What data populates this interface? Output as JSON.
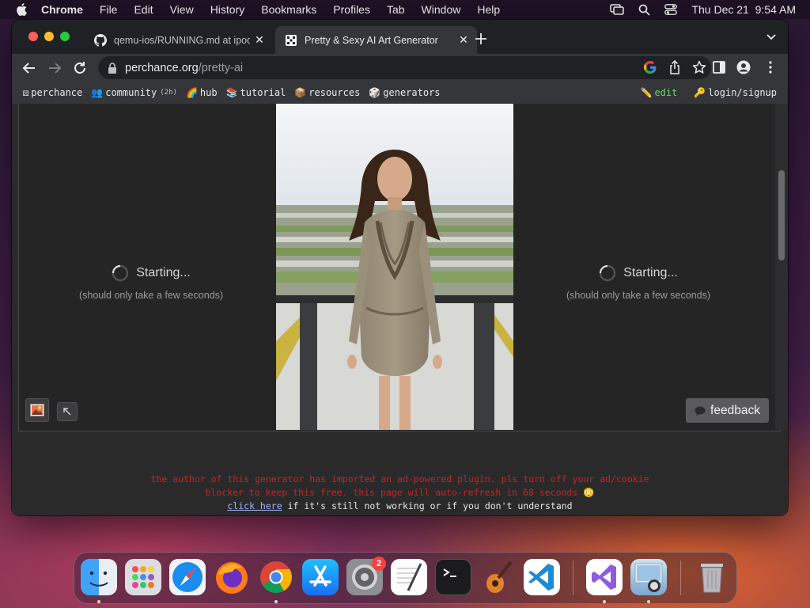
{
  "menubar": {
    "app": "Chrome",
    "items": [
      "File",
      "Edit",
      "View",
      "History",
      "Bookmarks",
      "Profiles",
      "Tab",
      "Window",
      "Help"
    ],
    "clock": "Thu Dec 21  9:54 AM"
  },
  "tabs": [
    {
      "title": "qemu-ios/RUNNING.md at ipod",
      "favicon": "github-icon",
      "active": false
    },
    {
      "title": "Pretty & Sexy AI Art Generator",
      "favicon": "perchance-icon",
      "active": true
    }
  ],
  "address": {
    "host": "perchance.org",
    "path": "/pretty-ai"
  },
  "bookmarks": {
    "items": [
      {
        "icon": "⚄",
        "label": "perchance"
      },
      {
        "icon": "👥",
        "label": "community",
        "note": "(2h)"
      },
      {
        "icon": "🌈",
        "label": "hub"
      },
      {
        "icon": "📚",
        "label": "tutorial"
      },
      {
        "icon": "📦",
        "label": "resources"
      },
      {
        "icon": "🎲",
        "label": "generators"
      }
    ],
    "edit": {
      "icon": "✏️",
      "label": "edit"
    },
    "login": {
      "icon": "🔑",
      "label": "login/signup"
    }
  },
  "panels": {
    "left": {
      "status": "Starting...",
      "sub": "(should only take a few seconds)"
    },
    "right": {
      "status": "Starting...",
      "sub": "(should only take a few seconds)"
    }
  },
  "feedback": {
    "label": "feedback"
  },
  "notice": {
    "line1": "the author of this generator has imported an ad-powered plugin. pls turn off your ad/cookie",
    "line2": "blocker to keep this free. this page will auto-refresh in 68 seconds 😳",
    "link": "click here",
    "rest": " if it's still not working or if you don't understand"
  },
  "dock": {
    "apps": [
      "Finder",
      "Launchpad",
      "Safari",
      "Firefox",
      "Chrome",
      "App Store",
      "System Settings",
      "TextEdit",
      "Terminal",
      "GarageBand",
      "Visual Studio Code",
      "Visual Studio",
      "Preview",
      "Trash"
    ],
    "settings_badge": "2"
  },
  "colors": {
    "accent_link": "#9fb4ff",
    "notice_red": "#cc2222",
    "feedback_bg": "#5a5a5c"
  }
}
